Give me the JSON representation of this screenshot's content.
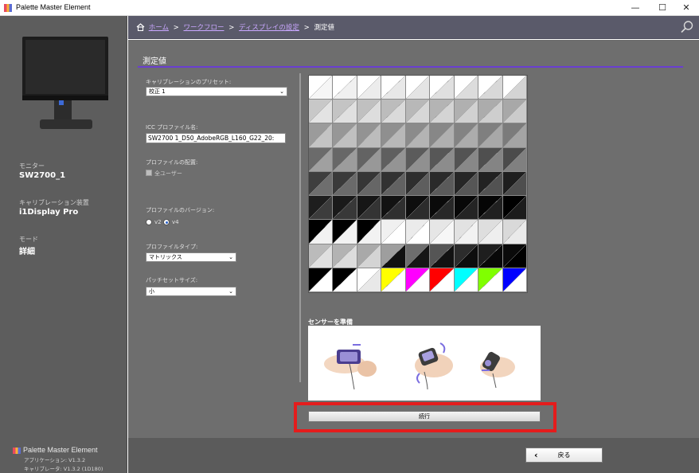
{
  "window": {
    "title": "Palette Master Element",
    "minimize": "—",
    "maximize": "☐",
    "close": "✕"
  },
  "sidebar": {
    "monitor_label": "モニター",
    "monitor_value": "SW2700_1",
    "device_label": "キャリブレーション装置",
    "device_value": "i1Display Pro",
    "mode_label": "モード",
    "mode_value": "詳細",
    "brand": "Palette Master Element",
    "app_version": "アプリケーション: V1.3.2",
    "calibrator_version": "キャリブレータ: V1.3.2 (1D180)"
  },
  "breadcrumb": {
    "home": "ホーム",
    "workflow": "ワークフロー",
    "display_settings": "ディスプレイの設定",
    "current": "測定値",
    "sep": ">"
  },
  "main": {
    "section_title": "測定値",
    "preset_label": "キャリブレーションのプリセット:",
    "preset_value": "校正 1",
    "icc_label": "ICC プロファイル名:",
    "icc_value": "SW2700 1_D50_AdobeRGB_L160_G22_20:",
    "distribution_label": "プロファイルの配置:",
    "all_users_label": "全ユーザー",
    "profile_version_label": "プロファイルのバージョン:",
    "v2_label": "v2",
    "v4_label": "v4",
    "profile_type_label": "プロファイルタイプ:",
    "profile_type_value": "マトリックス",
    "patch_set_label": "パッチセットサイズ:",
    "patch_set_value": "小",
    "sensor_title": "センサーを準備",
    "continue_label": "続行",
    "back_label": "戻る"
  },
  "patch_grid": [
    [
      [
        "#ffffff",
        "#f6f6f6"
      ],
      [
        "#ffffff",
        "#f0f0f0"
      ],
      [
        "#ffffff",
        "#ececec"
      ],
      [
        "#ffffff",
        "#e8e8e8"
      ],
      [
        "#ffffff",
        "#e4e4e4"
      ],
      [
        "#ffffff",
        "#e0e0e0"
      ],
      [
        "#ffffff",
        "#dcdcdc"
      ],
      [
        "#ffffff",
        "#d8d8d8"
      ],
      [
        "#ffffff",
        "#d4d4d4"
      ]
    ],
    [
      [
        "#c8c8c8",
        "#e3e3e3"
      ],
      [
        "#c4c4c4",
        "#e0e0e0"
      ],
      [
        "#c0c0c0",
        "#dddddd"
      ],
      [
        "#bcbcbc",
        "#dadada"
      ],
      [
        "#b8b8b8",
        "#d7d7d7"
      ],
      [
        "#b4b4b4",
        "#d4d4d4"
      ],
      [
        "#b0b0b0",
        "#d1d1d1"
      ],
      [
        "#acacac",
        "#cecece"
      ],
      [
        "#a8a8a8",
        "#cbcbcb"
      ]
    ],
    [
      [
        "#9b9b9b",
        "#c4c4c4"
      ],
      [
        "#979797",
        "#c0c0c0"
      ],
      [
        "#939393",
        "#bcbcbc"
      ],
      [
        "#8f8f8f",
        "#b8b8b8"
      ],
      [
        "#8b8b8b",
        "#b4b4b4"
      ],
      [
        "#878787",
        "#b0b0b0"
      ],
      [
        "#838383",
        "#acacac"
      ],
      [
        "#7f7f7f",
        "#a8a8a8"
      ],
      [
        "#7b7b7b",
        "#a4a4a4"
      ]
    ],
    [
      [
        "#6b6b6b",
        "#a0a0a0"
      ],
      [
        "#676767",
        "#9c9c9c"
      ],
      [
        "#636363",
        "#989898"
      ],
      [
        "#5f5f5f",
        "#949494"
      ],
      [
        "#5b5b5b",
        "#909090"
      ],
      [
        "#575757",
        "#8c8c8c"
      ],
      [
        "#535353",
        "#888888"
      ],
      [
        "#4f4f4f",
        "#848484"
      ],
      [
        "#4b4b4b",
        "#808080"
      ]
    ],
    [
      [
        "#3e3e3e",
        "#6e6e6e"
      ],
      [
        "#3a3a3a",
        "#6a6a6a"
      ],
      [
        "#363636",
        "#666666"
      ],
      [
        "#323232",
        "#626262"
      ],
      [
        "#2e2e2e",
        "#5e5e5e"
      ],
      [
        "#2a2a2a",
        "#5a5a5a"
      ],
      [
        "#262626",
        "#565656"
      ],
      [
        "#222222",
        "#525252"
      ],
      [
        "#1e1e1e",
        "#4e4e4e"
      ]
    ],
    [
      [
        "#1e1e1e",
        "#3c3c3c"
      ],
      [
        "#1a1a1a",
        "#383838"
      ],
      [
        "#161616",
        "#343434"
      ],
      [
        "#121212",
        "#303030"
      ],
      [
        "#0e0e0e",
        "#2c2c2c"
      ],
      [
        "#0a0a0a",
        "#282828"
      ],
      [
        "#080808",
        "#242424"
      ],
      [
        "#050505",
        "#202020"
      ],
      [
        "#000000",
        "#1c1c1c"
      ]
    ],
    [
      [
        "#000000",
        "#f2f2f2"
      ],
      [
        "#000000",
        "#f2f2f2"
      ],
      [
        "#000000",
        "#f2f2f2"
      ],
      [
        "#f0f0f0",
        "#ffffff"
      ],
      [
        "#ebebeb",
        "#ffffff"
      ],
      [
        "#e6e6e6",
        "#f7f7f7"
      ],
      [
        "#e2e2e2",
        "#f2f2f2"
      ],
      [
        "#dedede",
        "#eeeeee"
      ],
      [
        "#d9d9d9",
        "#eaeaea"
      ]
    ],
    [
      [
        "#bbbbbb",
        "#e0e0e0"
      ],
      [
        "#b3b3b3",
        "#dcdcdc"
      ],
      [
        "#a9a9a9",
        "#d4d4d4"
      ],
      [
        "#9e9e9e",
        "#111111"
      ],
      [
        "#6e6e6e",
        "#161616"
      ],
      [
        "#555555",
        "#121212"
      ],
      [
        "#2c2c2c",
        "#0d0d0d"
      ],
      [
        "#1e1e1e",
        "#080808"
      ],
      [
        "#0a0a0a",
        "#000000"
      ]
    ],
    [
      [
        "#000000",
        "#ffffff"
      ],
      [
        "#000000",
        "#ffffff"
      ],
      [
        "#ffffff",
        "#e8e8e8"
      ],
      [
        "#ffff00",
        "#ffffff"
      ],
      [
        "#ff00ff",
        "#ffffff"
      ],
      [
        "#ff0000",
        "#ffffff"
      ],
      [
        "#00ffff",
        "#ffffff"
      ],
      [
        "#80ff00",
        "#ffffff"
      ],
      [
        "#0000ff",
        "#ffffff"
      ]
    ]
  ]
}
